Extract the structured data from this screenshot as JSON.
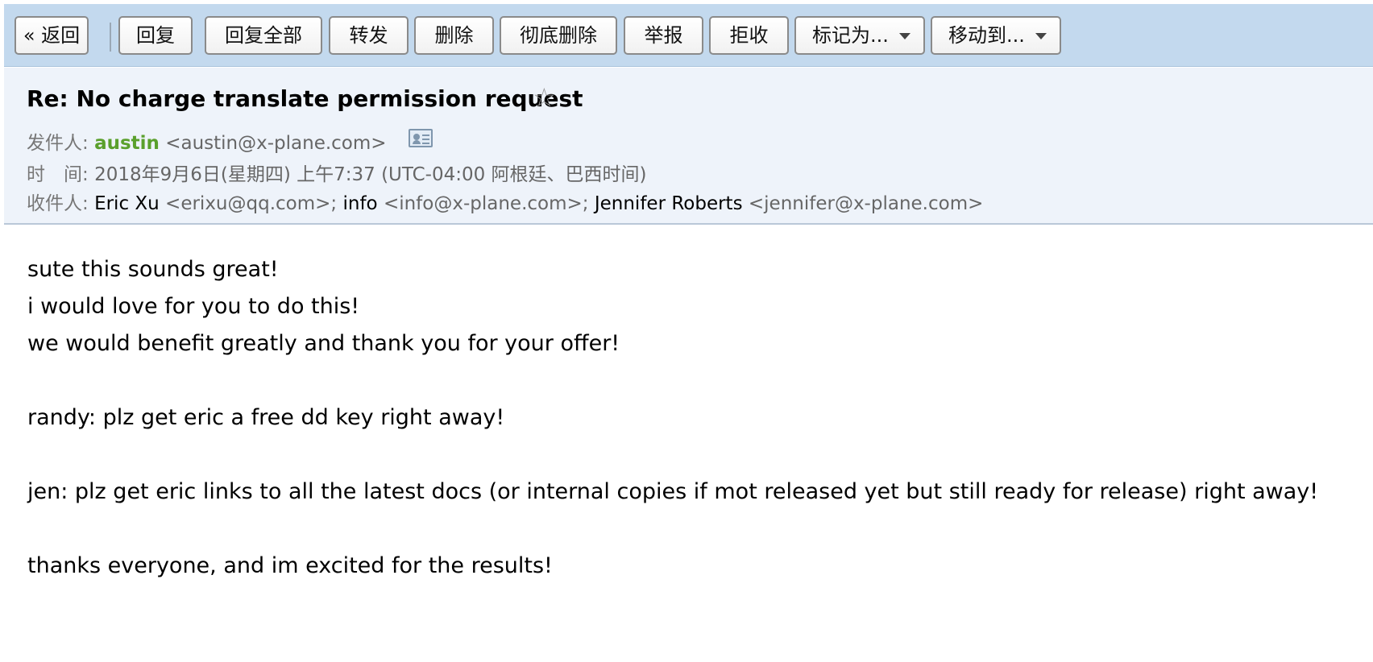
{
  "toolbar": {
    "back_label": "« 返回",
    "reply_label": "回复",
    "reply_all_label": "回复全部",
    "forward_label": "转发",
    "delete_label": "删除",
    "delete_permanent_label": "彻底删除",
    "report_label": "举报",
    "reject_label": "拒收",
    "mark_as_label": "标记为...",
    "move_to_label": "移动到..."
  },
  "email": {
    "subject": "Re: No charge translate permission request",
    "star_glyph": "☆",
    "from_label": "发件人:",
    "from_name": "austin",
    "from_address": "<austin@x-plane.com>",
    "time_label": "时　间:",
    "time_value": "2018年9月6日(星期四) 上午7:37 (UTC-04:00 阿根廷、巴西时间)",
    "to_label": "收件人:",
    "recipients": [
      {
        "name": "Eric Xu",
        "address": "<erixu@qq.com>",
        "sep": "; "
      },
      {
        "name": "info",
        "address": "<info@x-plane.com>",
        "sep": "; "
      },
      {
        "name": "Jennifer Roberts",
        "address": "<jennifer@x-plane.com>",
        "sep": ""
      }
    ],
    "body_lines": [
      "sute this sounds great!",
      "i would love for you to do this!",
      "we would benefit greatly and thank you for your offer!",
      "",
      "randy: plz get eric a free dd key right away!",
      "",
      "jen: plz get eric links to all the latest docs (or internal copies if mot released yet but still ready for release) right away!",
      "",
      "thanks everyone, and im excited for the results!"
    ]
  },
  "colors": {
    "toolbar_bg": "#c3d9ee",
    "header_bg": "#eef3fa",
    "sender_green": "#5aa02c"
  },
  "icons": {
    "contact_card": "contact-card-icon",
    "star": "star-icon",
    "dropdown": "chevron-down-icon"
  }
}
